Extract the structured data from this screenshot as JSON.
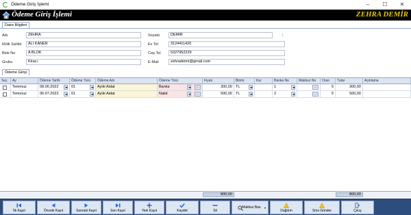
{
  "window": {
    "title": "Ödeme Giriş İşlemi"
  },
  "banner": {
    "title": "Ödeme Giriş İşlemi",
    "user_name": "ZEHRA DEMİR"
  },
  "tabs_top": [
    {
      "label": "Daire Bilgileri"
    }
  ],
  "daire": {
    "adi_label": "Adı",
    "adi": "ZEHRA",
    "soyadi_label": "Soyadı",
    "soyadi": "DEMİR",
    "soyadi_side": "1",
    "mulk_label": "Mülk Sahibi",
    "mulk": "ALİ KANER",
    "evtel_label": "Ev Tel",
    "evtel": "3124411420",
    "blok_label": "Blok No",
    "blok": "A BLOK",
    "ceptel_label": "Cep Tel",
    "ceptel": "5327952229",
    "grubu_label": "Grubu",
    "grubu": "Kiracı",
    "email_label": "E-Mail",
    "email": "zehrademir@gmail.com"
  },
  "tabs_mid": [
    {
      "label": "Ödeme Girişi"
    }
  ],
  "grid": {
    "columns": [
      "Seç",
      "Ay",
      "Ödeme Tarihi",
      "Ödeme Türü",
      "Ödeme Adı",
      "Ödeme Türü",
      "Fiyatı",
      "Birimi",
      "Kur",
      "Banka No",
      "Makbuz No",
      "Oran",
      "Tutar",
      "Açıklama"
    ],
    "rows": [
      {
        "ay": "Temmuz",
        "tarih": "08.06.2022",
        "tur_no": "01",
        "adi": "Aylık Aidat",
        "tur": "Banka",
        "fiyat": "300,00",
        "birim": "TL",
        "kur": "",
        "banka": "1",
        "makbuz": "",
        "oran": "5",
        "tutar": "300,00",
        "aciklama": ""
      },
      {
        "ay": "Temmuz",
        "tarih": "06.07.2022",
        "tur_no": "01",
        "adi": "Aylık Aidat",
        "tur": "Nakit",
        "fiyat": "500,00",
        "birim": "TL",
        "kur": "",
        "banka": "2",
        "makbuz": "",
        "oran": "5",
        "tutar": "500,00",
        "aciklama": ""
      }
    ]
  },
  "totals": {
    "fiyat_total": "800,00",
    "tutar_total": "800,00"
  },
  "toolbar": {
    "ilk": "İlk Kayıt",
    "onceki": "Önceki Kayıt",
    "sonraki": "Sonraki Kayıt",
    "son": "Son Kayıt",
    "yeni": "Yeni Kayıt",
    "kaydet": "Kaydet",
    "sil": "Sil",
    "makbuz": "Makbuz Bas",
    "dagitim": "Dağıtım",
    "sms": "Sms Gönder",
    "cikis": "Çıkış"
  },
  "colors": {
    "banner_bg": "#000000",
    "user_name": "#e8c800",
    "toolbar_bg": "#2c4d7e",
    "header_bg": "#dbe4f1"
  }
}
